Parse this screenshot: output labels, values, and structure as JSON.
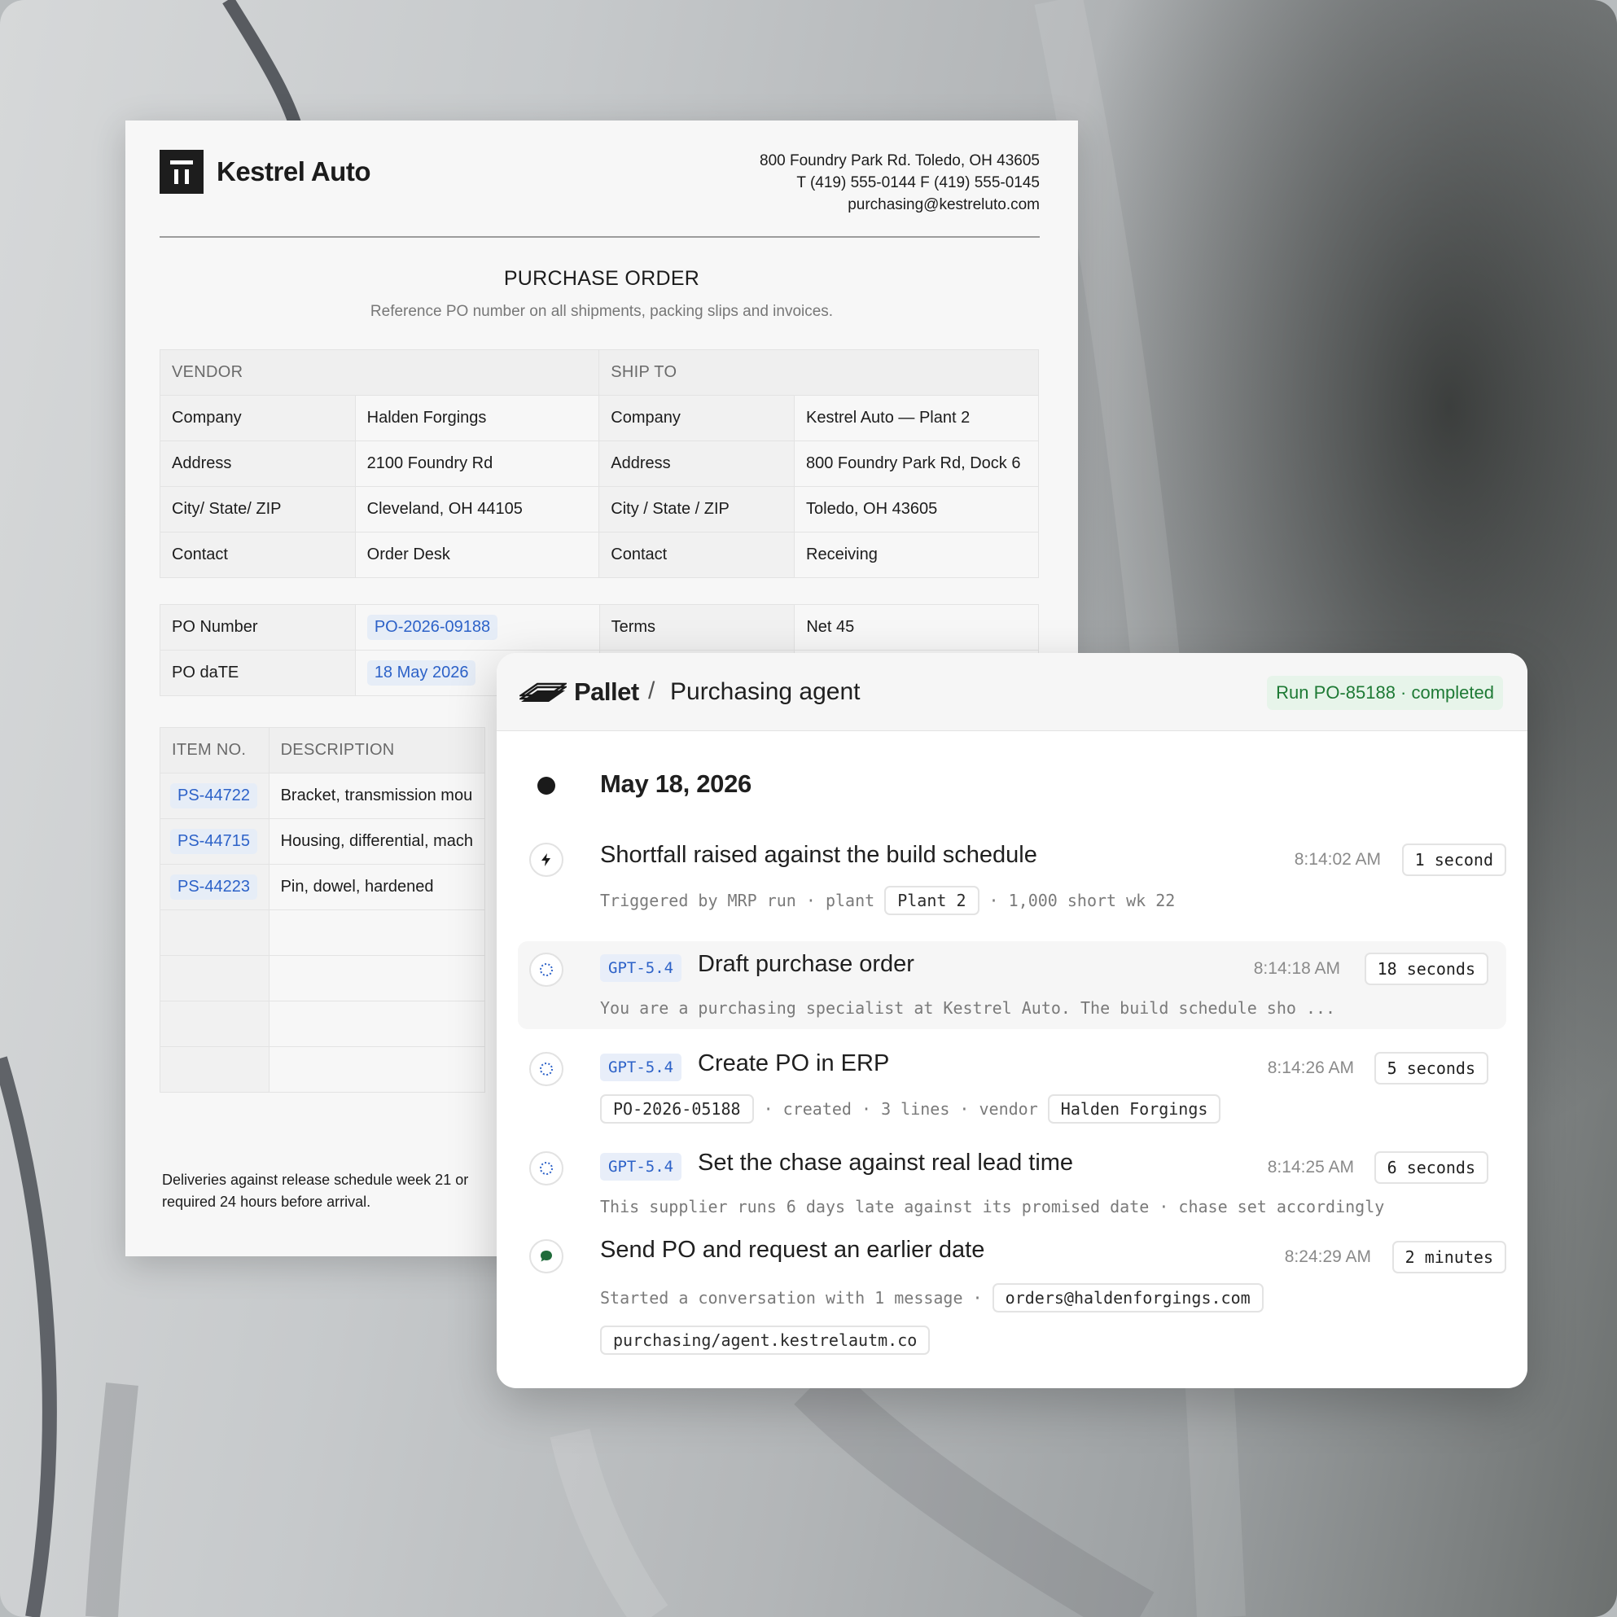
{
  "document": {
    "brand": "Kestrel Auto",
    "address_lines": [
      "800 Foundry Park Rd. Toledo, OH 43605",
      "T (419) 555-0144 F (419) 555-0145",
      "purchasing@kestreluto.com"
    ],
    "title": "PURCHASE ORDER",
    "subtitle": "Reference PO number on all shipments, packing slips and invoices.",
    "vendor_header": "VENDOR",
    "shipto_header": "SHIP TO",
    "vendor_rows": [
      {
        "label": "Company",
        "value": "Halden Forgings"
      },
      {
        "label": "Address",
        "value": "2100 Foundry Rd"
      },
      {
        "label": "City/ State/ ZIP",
        "value": "Cleveland, OH 44105"
      },
      {
        "label": "Contact",
        "value": "Order Desk"
      }
    ],
    "shipto_rows": [
      {
        "label": "Company",
        "value": "Kestrel Auto — Plant 2"
      },
      {
        "label": "Address",
        "value": "800 Foundry Park Rd, Dock 6"
      },
      {
        "label": "City / State / ZIP",
        "value": "Toledo, OH 43605"
      },
      {
        "label": "Contact",
        "value": "Receiving"
      }
    ],
    "po_number_label": "PO Number",
    "po_number": "PO-2026-09188",
    "terms_label": "Terms",
    "terms": "Net 45",
    "po_date_label": "PO daTE",
    "po_date": "18 May 2026",
    "items_header_no": "ITEM NO.",
    "items_header_desc": "DESCRIPTION",
    "items": [
      {
        "no": "PS-44722",
        "desc": "Bracket, transmission mou"
      },
      {
        "no": "PS-44715",
        "desc": "Housing, differential, mach"
      },
      {
        "no": "PS-44223",
        "desc": "Pin, dowel, hardened"
      }
    ],
    "footer_lines": [
      "Deliveries against release schedule week 21 or",
      "required 24 hours before arrival."
    ]
  },
  "panel": {
    "app_name": "Pallet",
    "separator": "/",
    "agent_name": "Purchasing agent",
    "run_status": "Run PO-85188 · completed",
    "date": "May 18, 2026",
    "steps": [
      {
        "title": "Shortfall raised against the build schedule",
        "icon": "lightning-icon",
        "time": "8:14:02 AM",
        "duration": "1 second",
        "meta_prefix": "Triggered by MRP run · plant",
        "meta_chip": "Plant 2",
        "meta_suffix": "· 1,000 short wk 22"
      },
      {
        "title": "Draft purchase order",
        "icon": "spinner-icon",
        "model": "GPT-5.4",
        "time": "8:14:18 AM",
        "duration": "18 seconds",
        "meta": "You are a purchasing specialist at Kestrel Auto. The build schedule sho ..."
      },
      {
        "title": "Create PO in ERP",
        "icon": "spinner-icon",
        "model": "GPT-5.4",
        "time": "8:14:26 AM",
        "duration": "5 seconds",
        "meta_chip1": "PO-2026-05188",
        "meta_mid": "· created · 3 lines · vendor",
        "meta_chip2": "Halden Forgings"
      },
      {
        "title": "Set the chase against real lead time",
        "icon": "spinner-icon",
        "model": "GPT-5.4",
        "time": "8:14:25 AM",
        "duration": "6 seconds",
        "meta": "This supplier runs 6 days late against its promised date · chase set accordingly"
      },
      {
        "title": "Send PO and request an earlier date",
        "icon": "chat-bubble-icon",
        "time": "8:24:29 AM",
        "duration": "2 minutes",
        "meta_prefix": "Started a conversation with 1 message ·",
        "meta_chip1": "orders@haldenforgings.com",
        "meta_chip2": "purchasing/agent.kestrelautm.co"
      }
    ]
  },
  "colors": {
    "accent_blue": "#2d62c8",
    "status_green": "#1e7a35",
    "chat_green": "#1f6b3a"
  }
}
